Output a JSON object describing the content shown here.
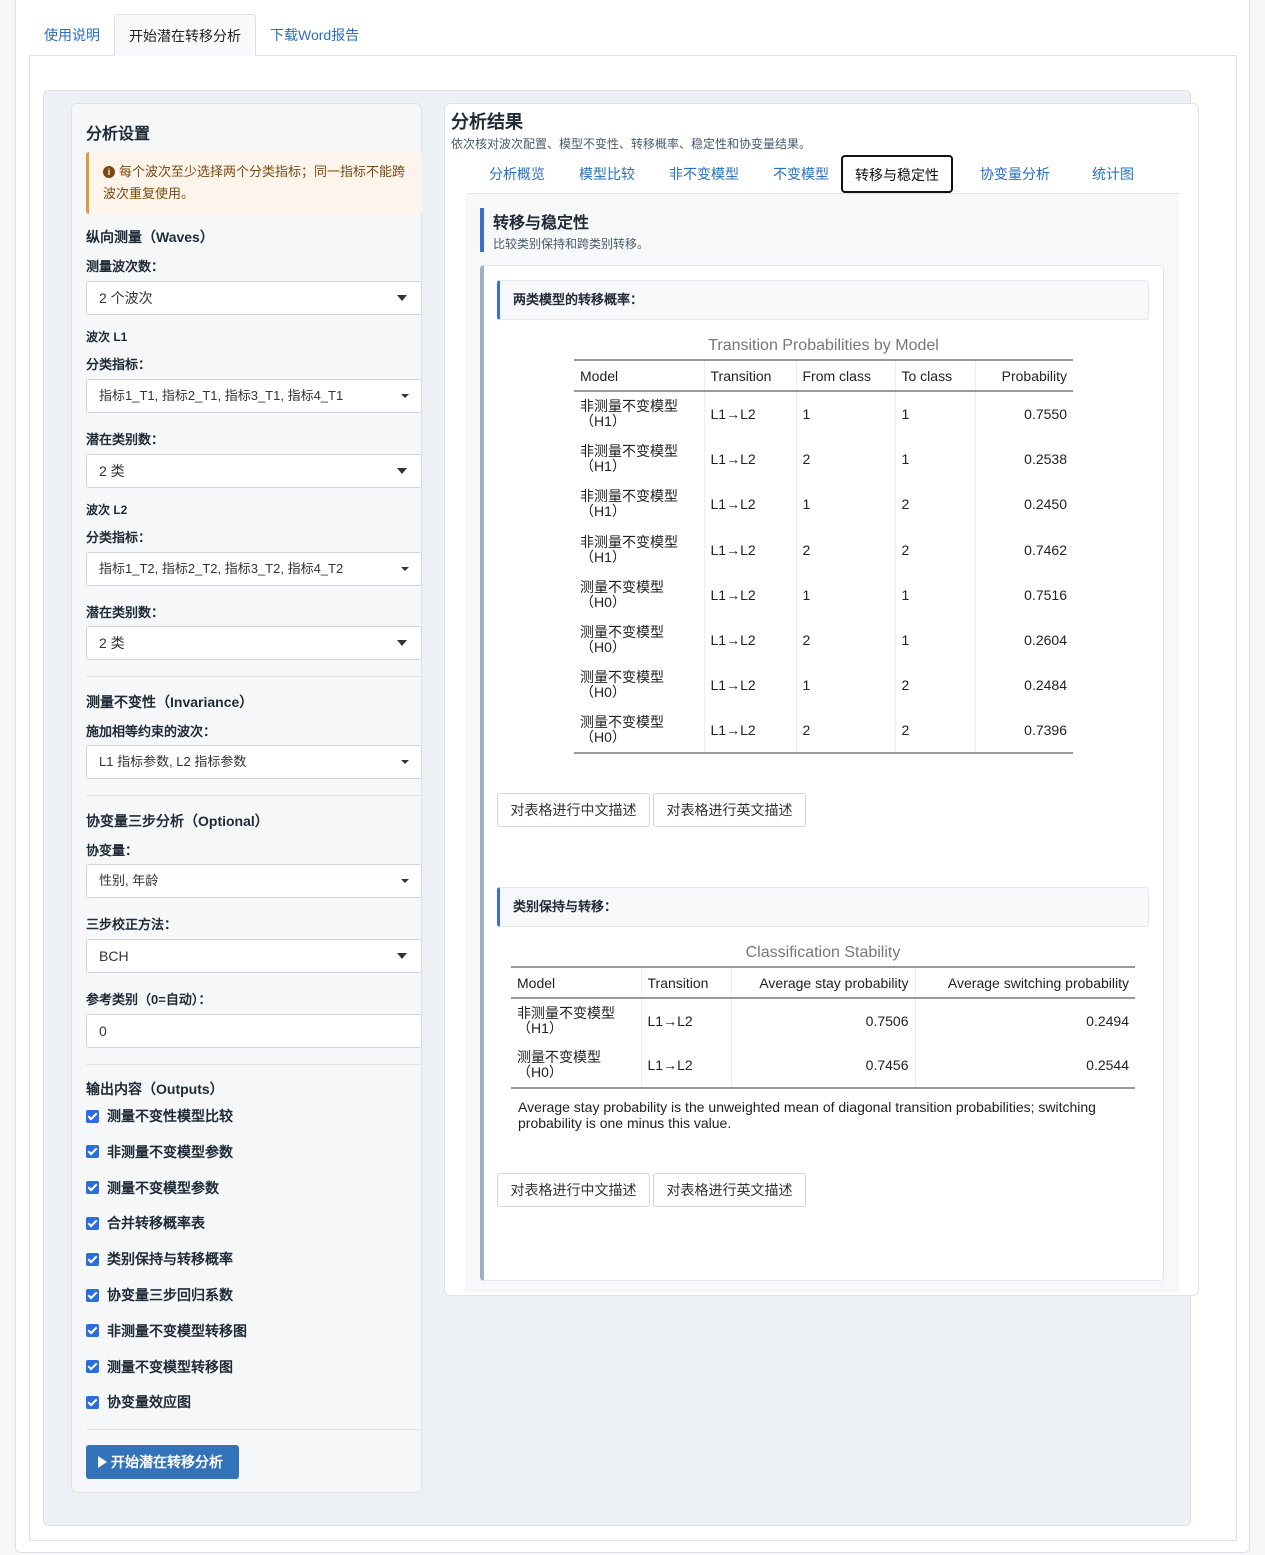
{
  "top_tabs": [
    {
      "label": "使用说明",
      "active": false
    },
    {
      "label": "开始潜在转移分析",
      "active": true
    },
    {
      "label": "下载Word报告",
      "active": false
    }
  ],
  "sidebar": {
    "title": "分析设置",
    "alert": "每个波次至少选择两个分类指标；同一指标不能跨波次重复使用。",
    "waves_section": "纵向测量（Waves）",
    "wave_count_label": "测量波次数：",
    "wave_count_value": "2 个波次",
    "wave1": {
      "title": "波次 L1",
      "indicators_label": "分类指标：",
      "indicators_value": "指标1_T1, 指标2_T1, 指标3_T1, 指标4_T1",
      "classes_label": "潜在类别数：",
      "classes_value": "2 类"
    },
    "wave2": {
      "title": "波次 L2",
      "indicators_label": "分类指标：",
      "indicators_value": "指标1_T2, 指标2_T2, 指标3_T2, 指标4_T2",
      "classes_label": "潜在类别数：",
      "classes_value": "2 类"
    },
    "invariance_section": "测量不变性（Invariance）",
    "invariance_label": "施加相等约束的波次：",
    "invariance_value": "L1 指标参数, L2 指标参数",
    "covariate_section": "协变量三步分析（Optional）",
    "covariate_label": "协变量：",
    "covariate_value": "性别, 年龄",
    "method_label": "三步校正方法：",
    "method_value": "BCH",
    "ref_label": "参考类别（0=自动）：",
    "ref_value": "0",
    "outputs_section": "输出内容（Outputs）",
    "outputs": [
      {
        "label": "测量不变性模型比较",
        "checked": true
      },
      {
        "label": "非测量不变模型参数",
        "checked": true
      },
      {
        "label": "测量不变模型参数",
        "checked": true
      },
      {
        "label": "合并转移概率表",
        "checked": true
      },
      {
        "label": "类别保持与转移概率",
        "checked": true
      },
      {
        "label": "协变量三步回归系数",
        "checked": true
      },
      {
        "label": "非测量不变模型转移图",
        "checked": true
      },
      {
        "label": "测量不变模型转移图",
        "checked": true
      },
      {
        "label": "协变量效应图",
        "checked": true
      }
    ],
    "run_button": "开始潜在转移分析"
  },
  "main": {
    "title": "分析结果",
    "subtitle": "依次核对波次配置、模型不变性、转移概率、稳定性和协变量结果。",
    "tabs": [
      {
        "label": "分析概览",
        "active": false
      },
      {
        "label": "模型比较",
        "active": false
      },
      {
        "label": "非不变模型",
        "active": false
      },
      {
        "label": "不变模型",
        "active": false
      },
      {
        "label": "转移与稳定性",
        "active": true
      },
      {
        "label": "协变量分析",
        "active": false
      },
      {
        "label": "统计图",
        "active": false
      }
    ],
    "section_title": "转移与稳定性",
    "section_subtitle": "比较类别保持和跨类别转移。",
    "block1": {
      "header": "两类模型的转移概率：",
      "caption": "Transition Probabilities by Model",
      "columns": [
        "Model",
        "Transition",
        "From class",
        "To class",
        "Probability"
      ],
      "rows": [
        {
          "model_a": "非测量不变模型",
          "model_b": "（H1）",
          "transition": "L1→L2",
          "from": "1",
          "to": "1",
          "prob": "0.7550"
        },
        {
          "model_a": "非测量不变模型",
          "model_b": "（H1）",
          "transition": "L1→L2",
          "from": "2",
          "to": "1",
          "prob": "0.2538"
        },
        {
          "model_a": "非测量不变模型",
          "model_b": "（H1）",
          "transition": "L1→L2",
          "from": "1",
          "to": "2",
          "prob": "0.2450"
        },
        {
          "model_a": "非测量不变模型",
          "model_b": "（H1）",
          "transition": "L1→L2",
          "from": "2",
          "to": "2",
          "prob": "0.7462"
        },
        {
          "model_a": "测量不变模型",
          "model_b": "（H0）",
          "transition": "L1→L2",
          "from": "1",
          "to": "1",
          "prob": "0.7516"
        },
        {
          "model_a": "测量不变模型",
          "model_b": "（H0）",
          "transition": "L1→L2",
          "from": "2",
          "to": "1",
          "prob": "0.2604"
        },
        {
          "model_a": "测量不变模型",
          "model_b": "（H0）",
          "transition": "L1→L2",
          "from": "1",
          "to": "2",
          "prob": "0.2484"
        },
        {
          "model_a": "测量不变模型",
          "model_b": "（H0）",
          "transition": "L1→L2",
          "from": "2",
          "to": "2",
          "prob": "0.7396"
        }
      ],
      "btn_cn": "对表格进行中文描述",
      "btn_en": "对表格进行英文描述"
    },
    "block2": {
      "header": "类别保持与转移：",
      "caption": "Classification Stability",
      "columns": [
        "Model",
        "Transition",
        "Average stay probability",
        "Average switching probability"
      ],
      "rows": [
        {
          "model_a": "非测量不变模型",
          "model_b": "（H1）",
          "transition": "L1→L2",
          "stay": "0.7506",
          "switch": "0.2494"
        },
        {
          "model_a": "测量不变模型",
          "model_b": "（H0）",
          "transition": "L1→L2",
          "stay": "0.7456",
          "switch": "0.2544"
        }
      ],
      "note": "Average stay probability is the unweighted mean of diagonal transition probabilities; switching probability is one minus this value.",
      "btn_cn": "对表格进行中文描述",
      "btn_en": "对表格进行英文描述"
    }
  },
  "colors": {
    "accent": "#3a6fd0",
    "link": "#2a6fc0",
    "run_button": "#3373b9",
    "alert_bg": "#fdf5eb",
    "alert_border": "#e09a3e"
  }
}
